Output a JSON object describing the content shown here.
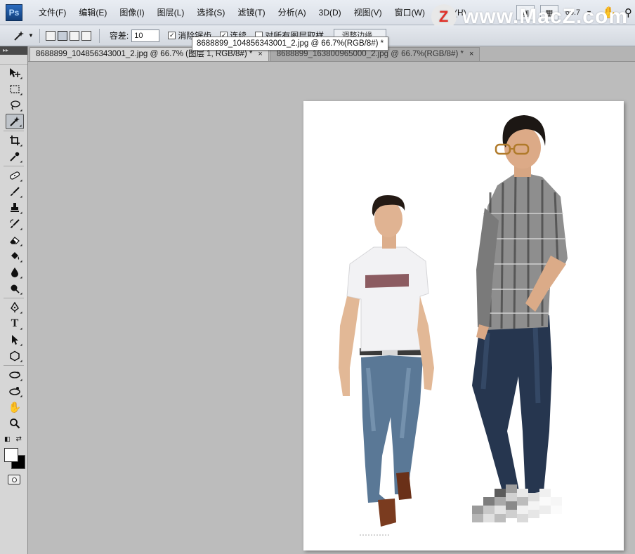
{
  "app": {
    "logo": "Ps"
  },
  "menu": {
    "items": [
      "文件(F)",
      "编辑(E)",
      "图像(I)",
      "图层(L)",
      "选择(S)",
      "滤镜(T)",
      "分析(A)",
      "3D(D)",
      "视图(V)",
      "窗口(W)",
      "帮助(H)"
    ],
    "zoom": "66.7"
  },
  "watermark": {
    "badge": "Z",
    "text": "www.MacZ.com"
  },
  "options": {
    "tolerance_label": "容差:",
    "tolerance_value": "10",
    "antialias_label": "消除锯齿",
    "antialias_checked": "✓",
    "contiguous_label": "连续",
    "contiguous_checked": "✓",
    "sample_all_label": "对所有图层取样",
    "refine_edge_label": "调整边缘..."
  },
  "tooltip": {
    "text": "8688899_104856343001_2.jpg @ 66.7%(RGB/8#) *"
  },
  "tabs": [
    {
      "label": "8688899_104856343001_2.jpg @ 66.7% (图层 1, RGB/8#) *",
      "close": "×"
    },
    {
      "label": "8688899_163800965000_2.jpg @ 66.7%(RGB/8#) *",
      "close": "×"
    }
  ],
  "toolbox": {
    "header": "▸▸"
  },
  "colors": {
    "foreground": "#ffffff",
    "background": "#000000"
  }
}
